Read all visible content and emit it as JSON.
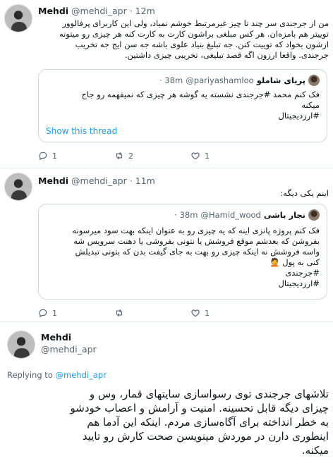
{
  "tweet1": {
    "name": "Mehdi",
    "handle": "@mehdi_apr",
    "time": "· 12m",
    "lines": [
      "من از جرجندی سر چند تا چیز غیرمرتبط خوشم نمیاد، ولی این کاربرای پرفالوور",
      "توییتر هم بامزه‌ان. هر کس مبلغی براشون کارت به کارت کنه هر چیزی رو میتونه",
      "ازشون بخواد که توییت کنن. جه تبلیغ بنیاد علوی باشه جه سن ایج جه تخریب",
      "جرجندی. واقعا ارزون اگه قصد تبلیغی، تخریبی چیزی داشتین."
    ],
    "quote": {
      "name": "پریای شاملو",
      "handle": "@pariyashamloo",
      "time": "· 38m",
      "lines": [
        "فک کنم محمد #جرجندی نشسته یه گوشه هر چیزی که نمیفهمه رو جاج",
        "میکنه",
        "#ارزدیجیتال"
      ]
    },
    "show_thread": "Show this thread",
    "reply_count": "1",
    "retweet_count": "2",
    "like_count": "1"
  },
  "tweet2": {
    "name": "Mehdi",
    "handle": "@mehdi_apr",
    "time": "· 11m",
    "lines": [
      "اینم یکی دیگه:"
    ],
    "quote": {
      "name": "نجار باشی",
      "handle": "@Hamid_wood",
      "time": "· 38m",
      "lines": [
        "فک کنم پروژه پانزی اینه که یه چیزی رو به عنوان اینکه بهت سود میرسونه",
        "بفروشن که بعدشم موقع فروشش یا نتونی بفروشی یا دهنت سرویس شه",
        "واسه فروشش نه اینکه چیزی رو بهت به جای گیفت بدن که بتونی تبدیلش",
        "کنی به پول 🤦",
        "#جرجندی",
        "#ارزدیجیتال"
      ]
    },
    "reply_count": "1",
    "retweet_count": "",
    "like_count": "1"
  },
  "tweet3": {
    "name": "Mehdi",
    "handle": "@mehdi_apr",
    "replying_prefix": "Replying to",
    "replying_to": "@mehdi_apr",
    "lines": [
      "تلاشهای جرجندی توی رسواسازی سایتهای قمار، وس و",
      "چیزای دیگه قابل تحسینه. امنیت و آرامش و اعصاب خودشو",
      "به خطر انداخته برای آگاه‌سازی مردم. اینکه این آدما هم",
      "اینطوری دارن در موردش مینویسن صحت کارش رو تایید",
      "میکنه."
    ]
  },
  "icons": [
    "avatar",
    "reply-icon",
    "retweet-icon",
    "like-icon"
  ],
  "colors": {
    "link": "#1d9bf0",
    "muted": "#536471",
    "border": "#cfd9de"
  }
}
